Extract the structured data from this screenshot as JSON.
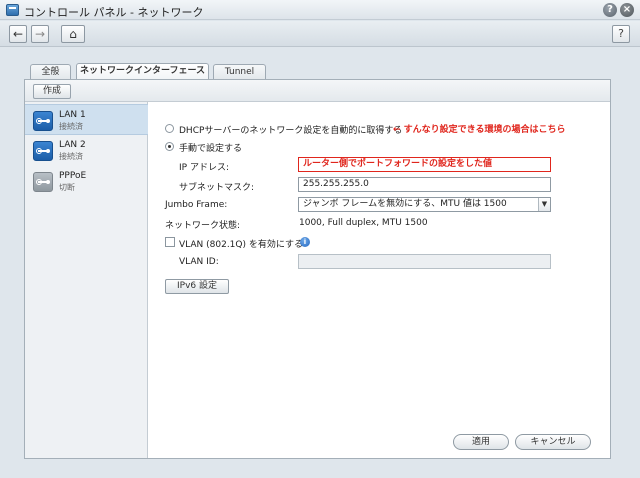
{
  "window": {
    "title": "コントロール パネル - ネットワーク",
    "help_glyph": "?",
    "close_glyph": "×"
  },
  "nav": {
    "back_glyph": "←",
    "forward_glyph": "→",
    "home_glyph": "⌂",
    "help_glyph": "?"
  },
  "tabs": [
    {
      "label": "全般",
      "active": false
    },
    {
      "label": "ネットワークインターフェース",
      "active": true
    },
    {
      "label": "Tunnel",
      "active": false
    }
  ],
  "toolbar": {
    "create_label": "作成"
  },
  "interfaces": [
    {
      "name": "LAN 1",
      "status": "接続済",
      "icon": "network-interface-icon",
      "selected": true
    },
    {
      "name": "LAN 2",
      "status": "接続済",
      "icon": "network-interface-icon",
      "selected": false
    },
    {
      "name": "PPPoE",
      "status": "切断",
      "icon": "pppoe-icon",
      "selected": false
    }
  ],
  "form": {
    "dhcp_label": "DHCPサーバーのネットワーク設定を自動的に取得する",
    "dhcp_selected": false,
    "dhcp_annotation": "← すんなり設定できる環境の場合はこちら",
    "manual_label": "手動で設定する",
    "manual_selected": true,
    "ip_label": "IP アドレス:",
    "ip_value": "ルーター側でポートフォワードの設定をした値",
    "subnet_label": "サブネットマスク:",
    "subnet_value": "255.255.255.0",
    "jumbo_label": "Jumbo Frame:",
    "jumbo_value": "ジャンボ フレームを無効にする、MTU 値は 1500",
    "network_status_label": "ネットワーク状態:",
    "network_status_value": "1000, Full duplex, MTU 1500",
    "vlan_label": "VLAN (802.1Q) を有効にする",
    "vlan_checked": false,
    "vlan_id_label": "VLAN ID:",
    "vlan_id_value": "",
    "ipv6_button": "IPv6 設定",
    "info_glyph": "i",
    "select_arrow": "▼"
  },
  "actions": {
    "apply_label": "適用",
    "cancel_label": "キャンセル"
  },
  "colors": {
    "annotation": "#e0261d",
    "selected_row": "#cfe0ef",
    "interface_icon": "#1c5ea8"
  }
}
